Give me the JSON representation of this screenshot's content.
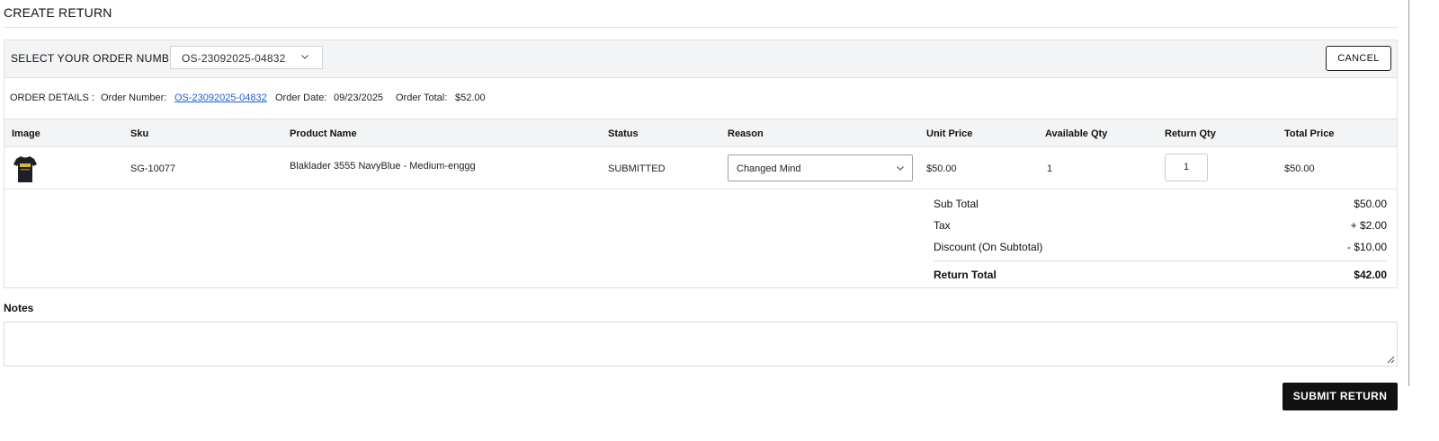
{
  "page": {
    "title": "CREATE RETURN"
  },
  "order_bar": {
    "label": "SELECT YOUR ORDER NUMBER",
    "selected_order": "OS-23092025-04832",
    "cancel_label": "CANCEL"
  },
  "order_details": {
    "heading": "ORDER DETAILS :",
    "number_label": "Order Number:",
    "number_value": "OS-23092025-04832",
    "date_label": "Order Date:",
    "date_value": "09/23/2025",
    "total_label": "Order Total:",
    "total_value": "$52.00"
  },
  "table": {
    "headers": [
      "Image",
      "Sku",
      "Product Name",
      "Status",
      "Reason",
      "Unit Price",
      "Available Qty",
      "Return Qty",
      "Total Price"
    ],
    "rows": [
      {
        "image_icon": "tshirt-thumbnail",
        "sku": "SG-10077",
        "product_name": "Blaklader 3555 NavyBlue - Medium-enggg",
        "status": "SUBMITTED",
        "reason": "Changed Mind",
        "unit_price": "$50.00",
        "available_qty": "1",
        "return_qty": "1",
        "total_price": "$50.00"
      }
    ]
  },
  "totals": {
    "subtotal_label": "Sub Total",
    "subtotal_value": "$50.00",
    "tax_label": "Tax",
    "tax_value": "+ $2.00",
    "discount_label": "Discount (On Subtotal)",
    "discount_value": "- $10.00",
    "return_total_label": "Return Total",
    "return_total_value": "$42.00"
  },
  "notes": {
    "label": "Notes",
    "value": ""
  },
  "actions": {
    "submit_label": "SUBMIT RETURN"
  },
  "colors": {
    "link": "#1a5fd6",
    "header_bg": "#f3f4f5",
    "submit_bg": "#111111"
  }
}
